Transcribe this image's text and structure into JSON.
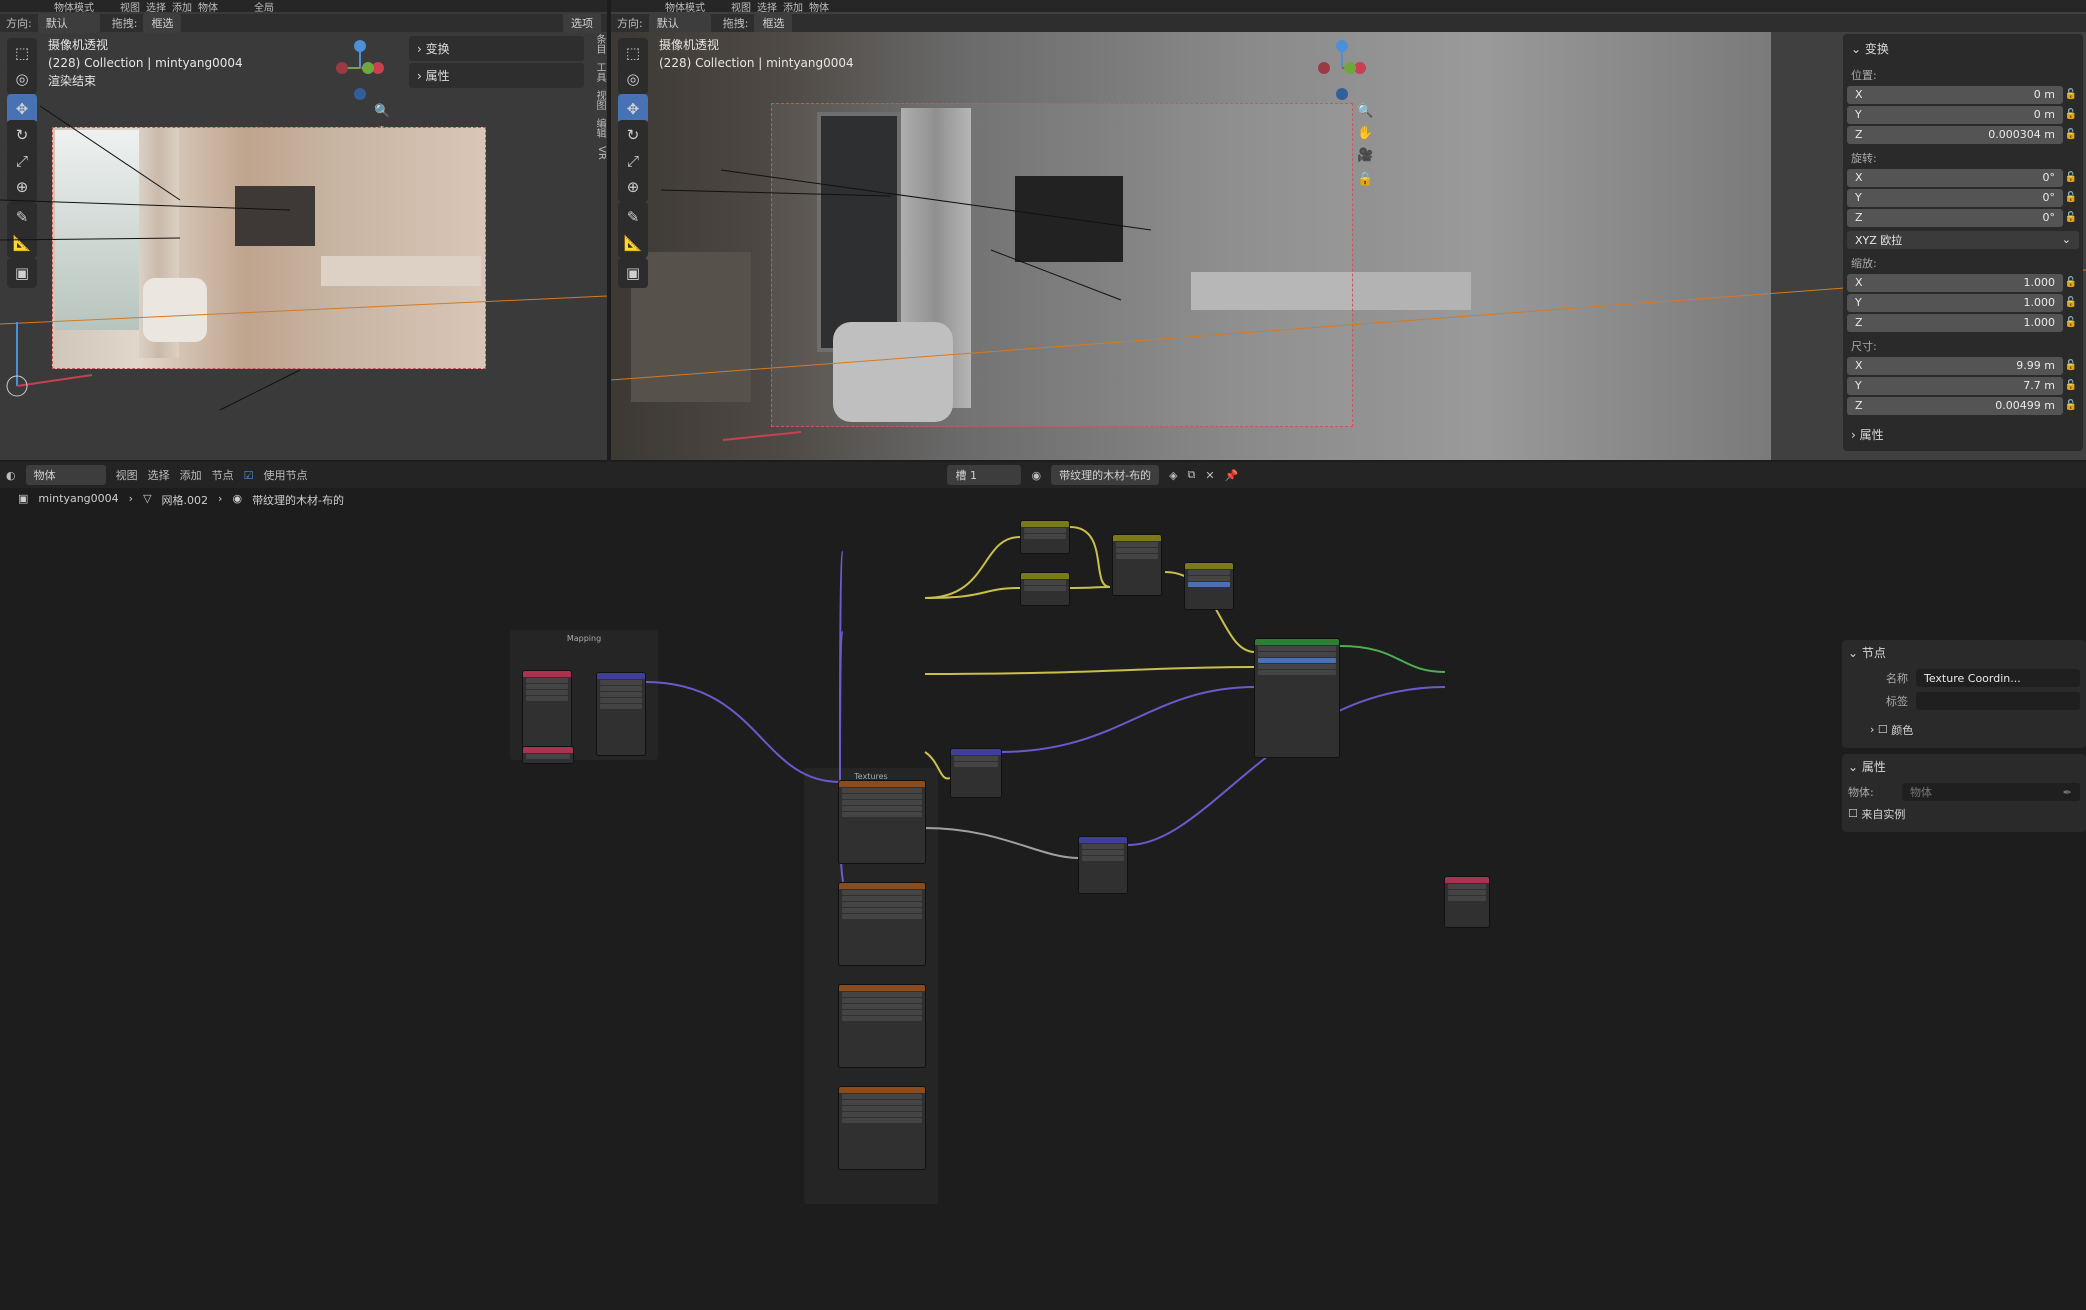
{
  "top_header": {
    "left_mode": "物体模式",
    "right_mode": "物体模式",
    "menus_left": [
      "视图",
      "选择",
      "添加",
      "物体"
    ],
    "menus_right": [
      "视图",
      "选择",
      "添加",
      "物体"
    ],
    "global": "全局"
  },
  "left_viewport": {
    "orientation_label": "方向:",
    "orientation_value": "默认",
    "drag_label": "拖拽:",
    "drag_value": "框选",
    "options": "选项",
    "overlay_title": "摄像机透视",
    "overlay_collection": "(228) Collection | mintyang0004",
    "overlay_status": "渲染结束",
    "panel_transform": "变换",
    "panel_properties": "属性",
    "side_tabs": [
      "条目",
      "工具",
      "视图",
      "编辑",
      "VR"
    ]
  },
  "right_viewport": {
    "orientation_label": "方向:",
    "orientation_value": "默认",
    "drag_label": "拖拽:",
    "drag_value": "框选",
    "overlay_title": "摄像机透视",
    "overlay_collection": "(228) Collection | mintyang0004"
  },
  "transform_panel": {
    "title": "变换",
    "location_label": "位置:",
    "location": [
      {
        "axis": "X",
        "value": "0 m"
      },
      {
        "axis": "Y",
        "value": "0 m"
      },
      {
        "axis": "Z",
        "value": "0.000304 m"
      }
    ],
    "rotation_label": "旋转:",
    "rotation": [
      {
        "axis": "X",
        "value": "0°"
      },
      {
        "axis": "Y",
        "value": "0°"
      },
      {
        "axis": "Z",
        "value": "0°"
      }
    ],
    "rotation_mode": "XYZ 欧拉",
    "scale_label": "缩放:",
    "scale": [
      {
        "axis": "X",
        "value": "1.000"
      },
      {
        "axis": "Y",
        "value": "1.000"
      },
      {
        "axis": "Z",
        "value": "1.000"
      }
    ],
    "dimensions_label": "尺寸:",
    "dimensions": [
      {
        "axis": "X",
        "value": "9.99 m"
      },
      {
        "axis": "Y",
        "value": "7.7 m"
      },
      {
        "axis": "Z",
        "value": "0.00499 m"
      }
    ],
    "properties": "属性"
  },
  "node_editor": {
    "header": {
      "object_type": "物体",
      "menus": [
        "视图",
        "选择",
        "添加",
        "节点"
      ],
      "use_nodes": "使用节点",
      "slot": "槽 1",
      "material": "带纹理的木材-布的"
    },
    "breadcrumb": [
      "mintyang0004",
      "网格.002",
      "带纹理的木材-布的"
    ],
    "frames": [
      "Mapping",
      "Textures"
    ]
  },
  "node_panel": {
    "section_node": "节点",
    "name_label": "名称",
    "name_value": "Texture Coordin...",
    "label_label": "标签",
    "color_label": "颜色",
    "section_props": "属性",
    "object_label": "物体:",
    "object_placeholder": "物体",
    "from_instancer": "来自实例"
  }
}
